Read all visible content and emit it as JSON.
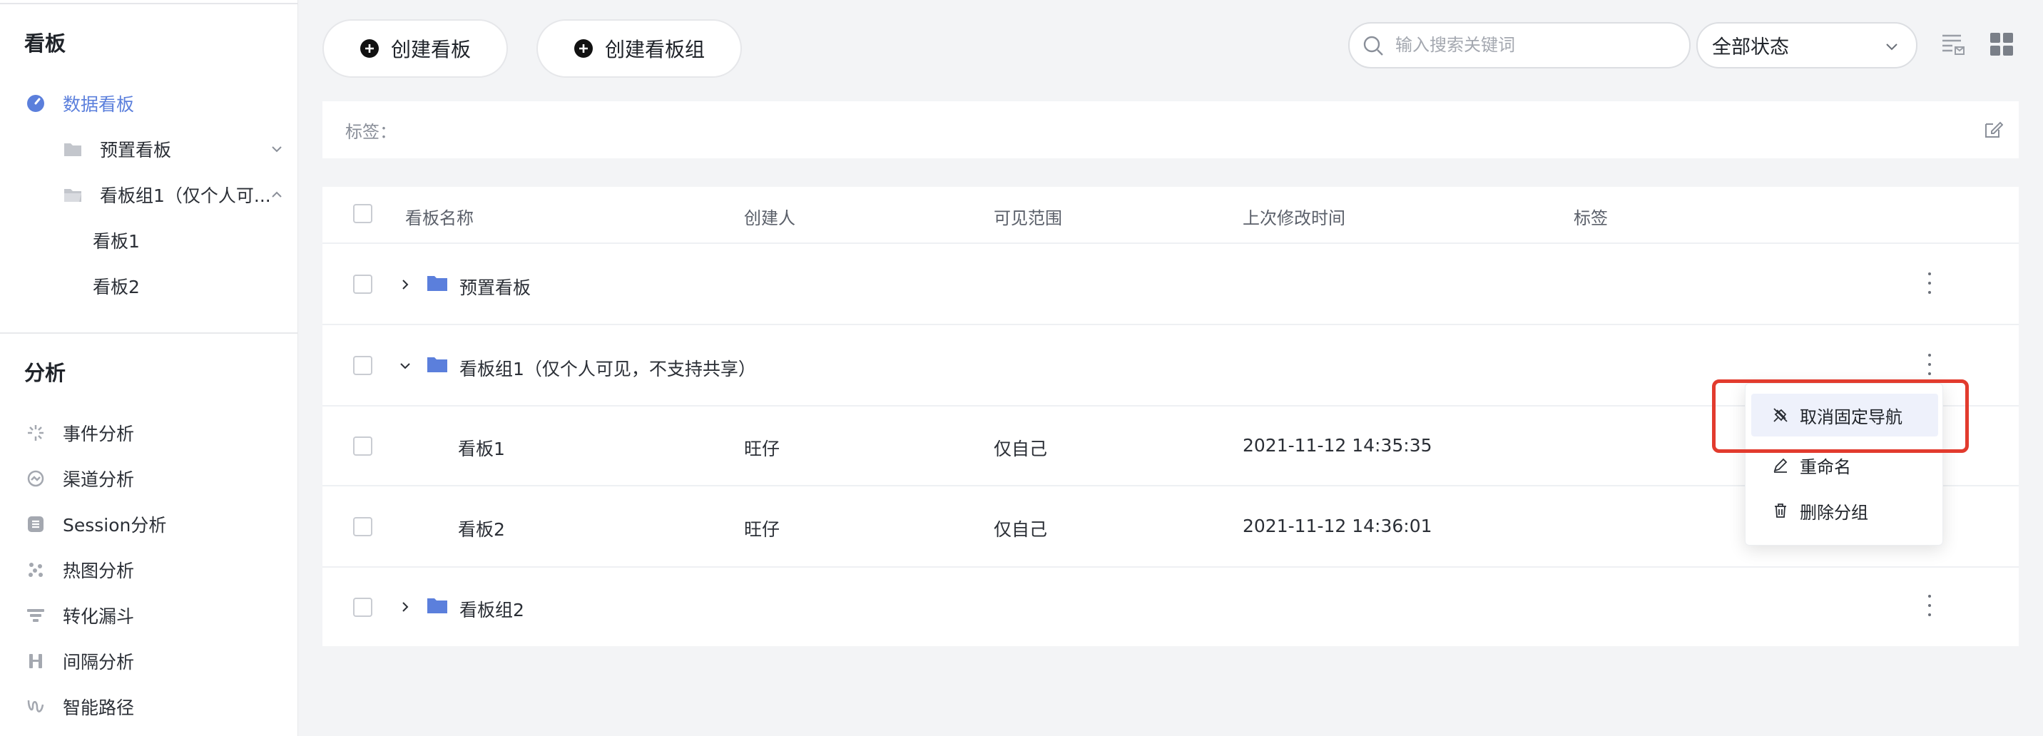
{
  "colors": {
    "accent": "#5b7fdc",
    "highlight": "#e23b2e"
  },
  "sidebar": {
    "kanban_title": "看板",
    "kanban_items": [
      {
        "label": "数据看板",
        "icon": "dashboard-icon",
        "active": true
      },
      {
        "label": "预置看板",
        "icon": "folder-icon"
      },
      {
        "label": "看板组1（仅个人可...",
        "icon": "folder-open-icon"
      },
      {
        "label": "看板1"
      },
      {
        "label": "看板2"
      }
    ],
    "analysis_title": "分析",
    "analysis_items": [
      {
        "label": "事件分析",
        "icon": "event-icon"
      },
      {
        "label": "渠道分析",
        "icon": "channel-icon"
      },
      {
        "label": "Session分析",
        "icon": "session-icon"
      },
      {
        "label": "热图分析",
        "icon": "heatmap-icon"
      },
      {
        "label": "转化漏斗",
        "icon": "funnel-icon"
      },
      {
        "label": "间隔分析",
        "icon": "interval-icon"
      },
      {
        "label": "智能路径",
        "icon": "path-icon"
      }
    ]
  },
  "toolbar": {
    "create_board": "创建看板",
    "create_group": "创建看板组",
    "search_placeholder": "输入搜索关键词",
    "status_select": "全部状态"
  },
  "tagbar": {
    "label": "标签："
  },
  "table": {
    "columns": [
      "看板名称",
      "创建人",
      "可见范围",
      "上次修改时间",
      "标签"
    ],
    "rows": [
      {
        "type": "folder",
        "name": "预置看板",
        "expanded": false
      },
      {
        "type": "folder",
        "name": "看板组1（仅个人可见，不支持共享）",
        "expanded": true
      },
      {
        "type": "board",
        "name": "看板1",
        "creator": "旺仔",
        "visibility": "仅自己",
        "modified": "2021-11-12 14:35:35"
      },
      {
        "type": "board",
        "name": "看板2",
        "creator": "旺仔",
        "visibility": "仅自己",
        "modified": "2021-11-12 14:36:01"
      },
      {
        "type": "folder",
        "name": "看板组2",
        "expanded": false
      }
    ]
  },
  "context_menu": {
    "items": [
      {
        "label": "取消固定导航",
        "icon": "unpin-icon"
      },
      {
        "label": "重命名",
        "icon": "edit-icon"
      },
      {
        "label": "删除分组",
        "icon": "trash-icon"
      }
    ]
  }
}
